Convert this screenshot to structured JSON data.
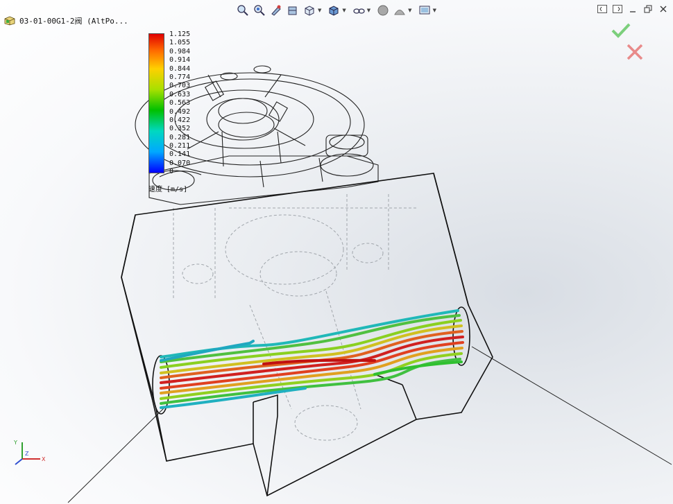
{
  "document": {
    "title": "03-01-00G1-2阀  (AltPo..."
  },
  "toolbar": {
    "buttons": [
      {
        "name": "zoom-to-fit-icon",
        "dropdown": false
      },
      {
        "name": "zoom-to-area-icon",
        "dropdown": false
      },
      {
        "name": "previous-view-icon",
        "dropdown": false
      },
      {
        "name": "section-view-icon",
        "dropdown": false
      },
      {
        "name": "view-orientation-icon",
        "dropdown": true
      },
      {
        "name": "display-style-icon",
        "dropdown": true
      },
      {
        "name": "hide-show-items-icon",
        "dropdown": true
      },
      {
        "name": "edit-appearance-icon",
        "dropdown": false
      },
      {
        "name": "apply-scene-icon",
        "dropdown": true
      },
      {
        "name": "view-settings-icon",
        "dropdown": true
      }
    ]
  },
  "legend": {
    "values": [
      "1.125",
      "1.055",
      "0.984",
      "0.914",
      "0.844",
      "0.774",
      "0.703",
      "0.633",
      "0.563",
      "0.492",
      "0.422",
      "0.352",
      "0.281",
      "0.211",
      "0.141",
      "0.070",
      "0"
    ],
    "unit_label": "速度 [m/s]",
    "max": 1.125,
    "min": 0
  },
  "triad": {
    "x": "X",
    "y": "Y",
    "z": "Z"
  },
  "colors": {
    "accept": "#7ccf7c",
    "cancel": "#e88a8a",
    "edges": "#111111",
    "hidden_edges": "#9aa0a6"
  }
}
